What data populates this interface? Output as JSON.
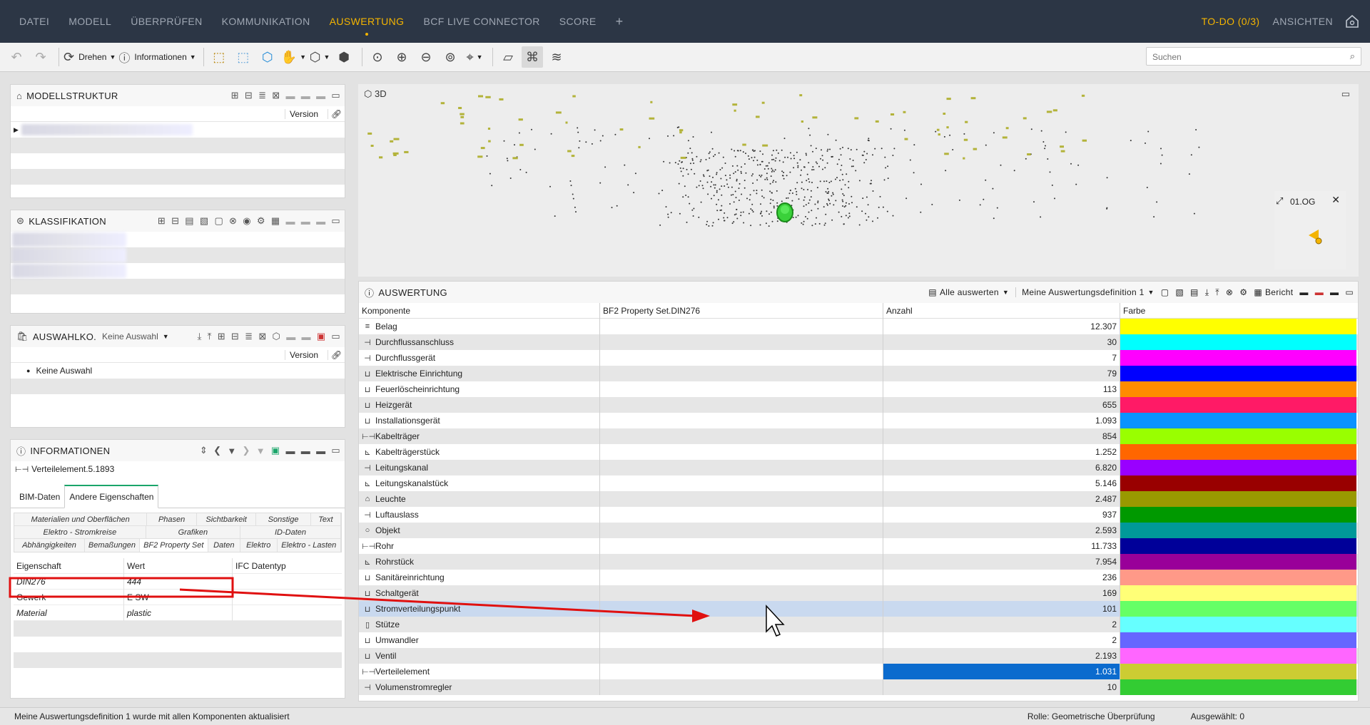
{
  "menu": {
    "items": [
      "DATEI",
      "MODELL",
      "ÜBERPRÜFEN",
      "KOMMUNIKATION",
      "AUSWERTUNG",
      "BCF LIVE CONNECTOR",
      "SCORE",
      "+"
    ],
    "active": "AUSWERTUNG",
    "todo": "TO-DO (0/3)",
    "views": "ANSICHTEN"
  },
  "toolbar": {
    "rotate_label": "Drehen",
    "info_label": "Informationen",
    "search_placeholder": "Suchen"
  },
  "model_structure": {
    "title": "MODELLSTRUKTUR",
    "version_label": "Version"
  },
  "classification": {
    "title": "KLASSIFIKATION"
  },
  "selection": {
    "title": "AUSWAHLKO.",
    "dropdown": "Keine Auswahl",
    "version_label": "Version",
    "item": "Keine Auswahl"
  },
  "information": {
    "title": "INFORMATIONEN",
    "element": "Verteilelement.5.1893",
    "tabs": [
      "BIM-Daten",
      "Andere Eigenschaften"
    ],
    "active_tab": "Andere Eigenschaften",
    "property_tabs_row1": [
      "Materialien und Oberflächen",
      "Phasen",
      "Sichtbarkeit",
      "Sonstige",
      "Text"
    ],
    "property_tabs_row2": [
      "Elektro - Stromkreise",
      "Grafiken",
      "ID-Daten"
    ],
    "property_tabs_row3": [
      "Abhängigkeiten",
      "Bemaßungen",
      "BF2 Property Set",
      "Daten",
      "Elektro",
      "Elektro - Lasten"
    ],
    "columns": [
      "Eigenschaft",
      "Wert",
      "IFC Datentyp"
    ],
    "rows": [
      {
        "name": "DIN276",
        "value": "444",
        "type": ""
      },
      {
        "name": "Gewerk",
        "value": "E SW",
        "type": ""
      },
      {
        "name": "Material",
        "value": "plastic",
        "type": ""
      }
    ]
  },
  "viewport": {
    "title": "3D",
    "floor_label": "01.OG"
  },
  "evaluation": {
    "title": "AUSWERTUNG",
    "all_label": "Alle auswerten",
    "definition": "Meine Auswertungsdefinition 1",
    "report": "Bericht",
    "columns": [
      "Komponente",
      "BF2 Property Set.DIN276",
      "Anzahl",
      "Farbe"
    ],
    "rows": [
      {
        "name": "Belag",
        "count": "12.307",
        "color": "#ffff00"
      },
      {
        "name": "Durchflussanschluss",
        "count": "30",
        "color": "#00ffff"
      },
      {
        "name": "Durchflussgerät",
        "count": "7",
        "color": "#ff00ff"
      },
      {
        "name": "Elektrische Einrichtung",
        "count": "79",
        "color": "#0000ff"
      },
      {
        "name": "Feuerlöscheinrichtung",
        "count": "113",
        "color": "#ff8c00"
      },
      {
        "name": "Heizgerät",
        "count": "655",
        "color": "#ff1a66"
      },
      {
        "name": "Installationsgerät",
        "count": "1.093",
        "color": "#0a93ff"
      },
      {
        "name": "Kabelträger",
        "count": "854",
        "color": "#99ff00"
      },
      {
        "name": "Kabelträgerstück",
        "count": "1.252",
        "color": "#ff6600"
      },
      {
        "name": "Leitungskanal",
        "count": "6.820",
        "color": "#9900ff"
      },
      {
        "name": "Leitungskanalstück",
        "count": "5.146",
        "color": "#990000"
      },
      {
        "name": "Leuchte",
        "count": "2.487",
        "color": "#999900"
      },
      {
        "name": "Luftauslass",
        "count": "937",
        "color": "#009900"
      },
      {
        "name": "Objekt",
        "count": "2.593",
        "color": "#009999"
      },
      {
        "name": "Rohr",
        "count": "11.733",
        "color": "#000099"
      },
      {
        "name": "Rohrstück",
        "count": "7.954",
        "color": "#990099"
      },
      {
        "name": "Sanitäreinrichtung",
        "count": "236",
        "color": "#ff9988"
      },
      {
        "name": "Schaltgerät",
        "count": "169",
        "color": "#ffff77"
      },
      {
        "name": "Stromverteilungspunkt",
        "count": "101",
        "color": "#66ff66"
      },
      {
        "name": "Stütze",
        "count": "2",
        "color": "#66ffff"
      },
      {
        "name": "Umwandler",
        "count": "2",
        "color": "#6666ff"
      },
      {
        "name": "Ventil",
        "count": "2.193",
        "color": "#ff66ff"
      },
      {
        "name": "Verteilelement",
        "count": "1.031",
        "color": "#cccc33"
      },
      {
        "name": "Volumenstromregler",
        "count": "10",
        "color": "#33cc33"
      }
    ],
    "selected_row": "Stromverteilungspunkt",
    "highlight_count_row": "Verteilelement"
  },
  "status": {
    "message": "Meine Auswertungsdefinition 1 wurde mit allen Komponenten aktualisiert",
    "role": "Rolle: Geometrische Überprüfung",
    "selected": "Ausgewählt: 0"
  }
}
